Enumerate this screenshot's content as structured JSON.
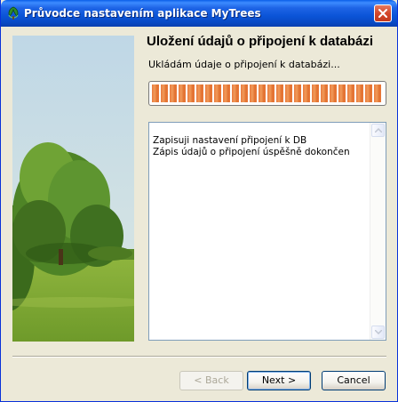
{
  "window": {
    "title": "Průvodce nastavením aplikace MyTrees"
  },
  "header": {
    "title": "Uložení údajů o připojení k databázi",
    "subtitle": "Ukládám údaje o připojení k databázi..."
  },
  "progress": {
    "value": 1.0
  },
  "log": {
    "lines": [
      "Zapisuji nastavení připojení k DB",
      "Zápis údajů o připojení úspěšně dokončen"
    ]
  },
  "buttons": {
    "back": "< Back",
    "next": "Next >",
    "cancel": "Cancel"
  },
  "icons": {
    "app": "tree-icon",
    "close": "close-icon"
  },
  "colors": {
    "titlebar": "#0A5FE8",
    "progress": "#E97A3D",
    "dialog_bg": "#ECE9D8"
  }
}
